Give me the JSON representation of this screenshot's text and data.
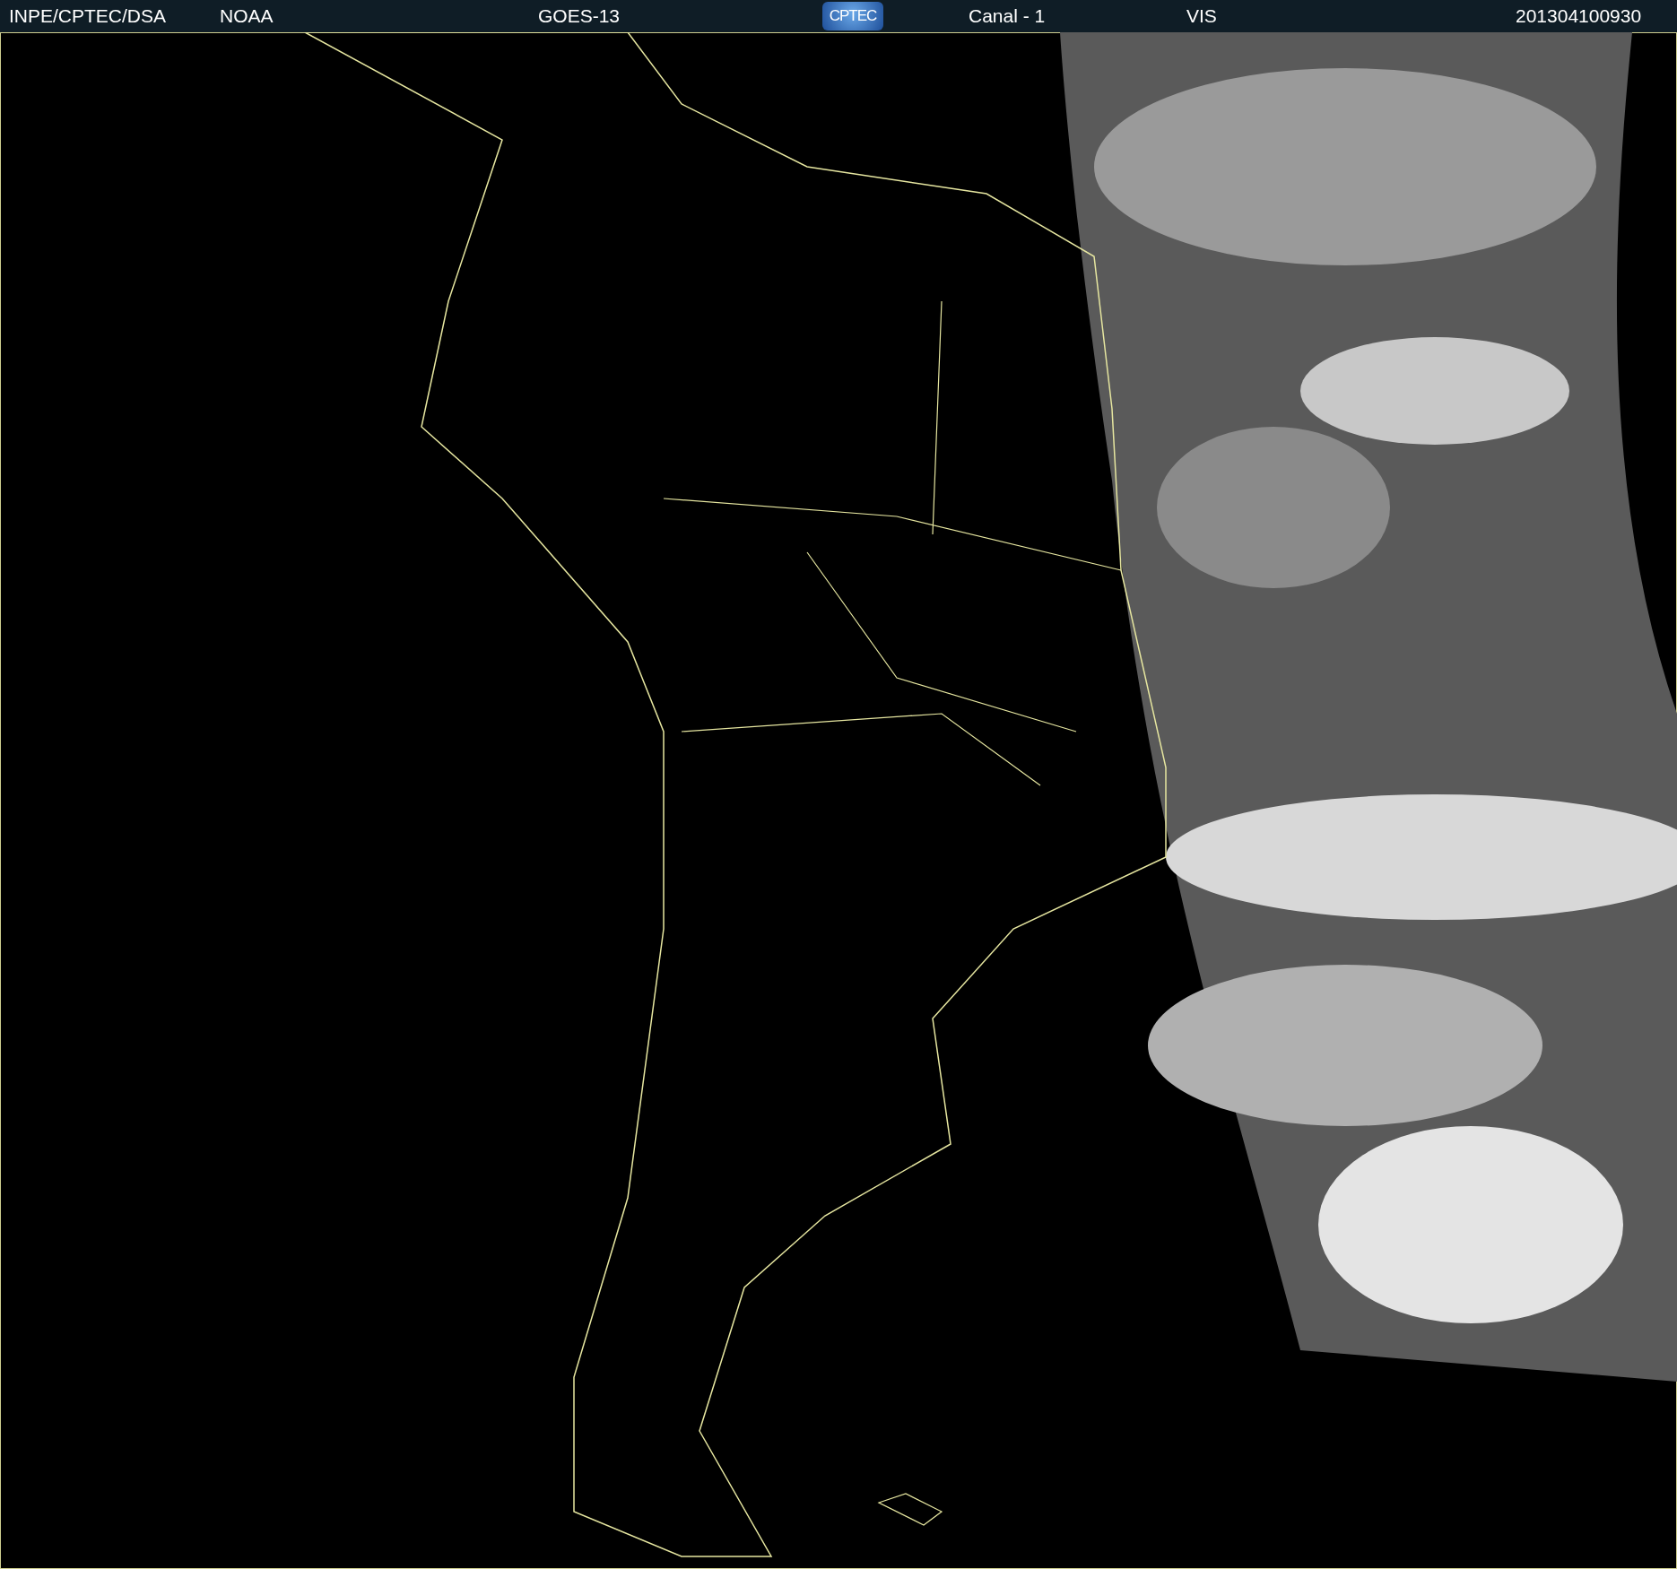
{
  "header": {
    "source": "INPE/CPTEC/DSA",
    "agency": "NOAA",
    "satellite": "GOES-13",
    "logo": "CPTEC",
    "channel": "Canal - 1",
    "band": "VIS",
    "timestamp": "201304100930"
  }
}
